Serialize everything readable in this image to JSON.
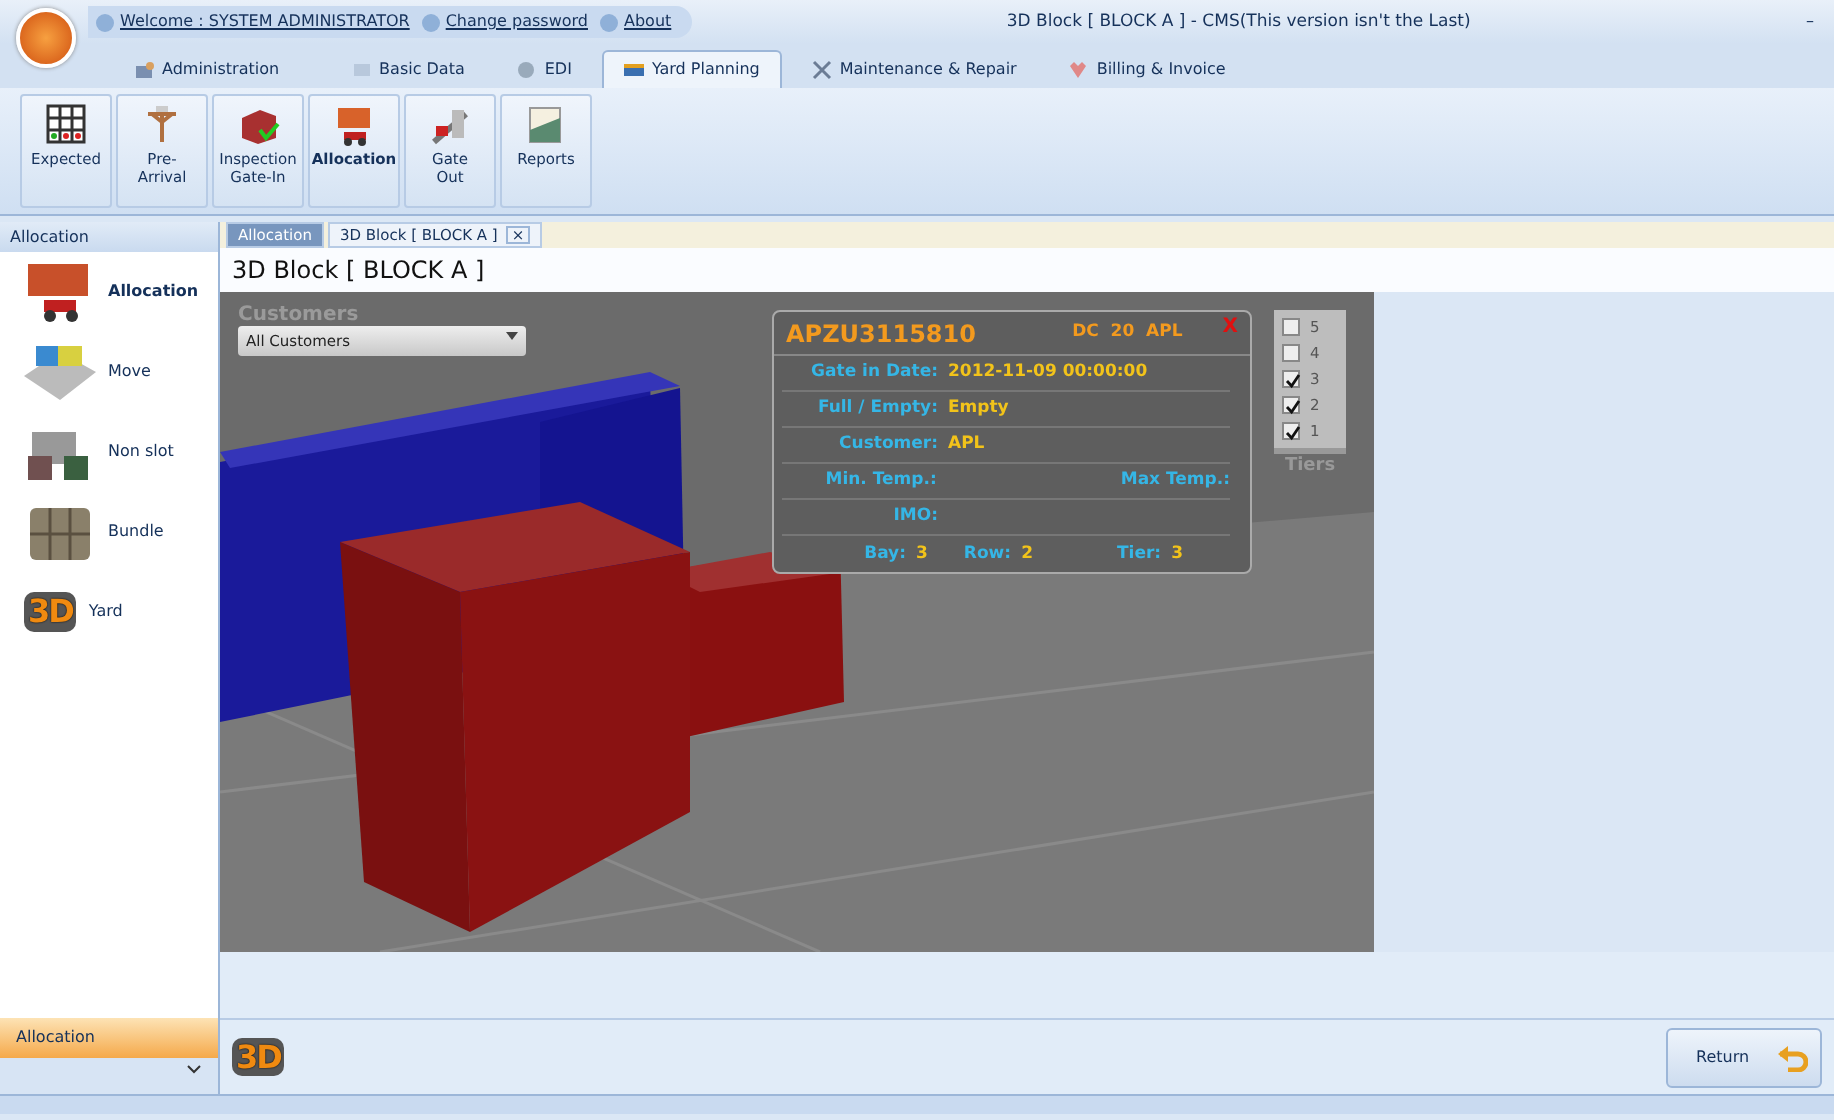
{
  "title_bar": {
    "links": [
      "Welcome : SYSTEM ADMINISTRATOR",
      "Change password",
      "About"
    ],
    "title": "3D Block [ BLOCK A ] - CMS(This version isn't the Last)",
    "minimize": "–"
  },
  "menu_tabs": [
    {
      "label": "Administration",
      "selected": false
    },
    {
      "label": "Basic Data",
      "selected": false
    },
    {
      "label": "EDI",
      "selected": false
    },
    {
      "label": "Yard Planning",
      "selected": true
    },
    {
      "label": "Maintenance & Repair",
      "selected": false
    },
    {
      "label": "Billing & Invoice",
      "selected": false
    }
  ],
  "ribbon": [
    {
      "label": "Expected",
      "kind": "grid",
      "selected": false
    },
    {
      "label": "Pre-Arrival",
      "kind": "crane",
      "selected": false
    },
    {
      "label": "Inspection Gate-In",
      "kind": "inspect",
      "selected": false
    },
    {
      "label": "Allocation",
      "kind": "alloc",
      "selected": true
    },
    {
      "label": "Gate Out",
      "kind": "gate",
      "selected": false
    },
    {
      "label": "Reports",
      "kind": "report",
      "selected": false
    }
  ],
  "sidebar": {
    "header": "Allocation",
    "items": [
      {
        "label": "Allocation",
        "kind": "alloc",
        "selected": true
      },
      {
        "label": "Move",
        "kind": "move",
        "selected": false
      },
      {
        "label": "Non slot",
        "kind": "nonslot",
        "selected": false
      },
      {
        "label": "Bundle",
        "kind": "bundle",
        "selected": false
      },
      {
        "label": "Yard",
        "kind": "yard",
        "badge": "3D",
        "selected": false
      }
    ],
    "footer": "Allocation"
  },
  "doc_tabs": [
    {
      "label": "Allocation",
      "selected": true
    },
    {
      "label": "3D Block [ BLOCK A ]",
      "selected": false,
      "close": "×"
    }
  ],
  "page_title": "3D Block [ BLOCK A ]",
  "viewer": {
    "customers_label": "Customers",
    "customer_select": "All Customers",
    "popup": {
      "container": "APZU3115810",
      "type": "DC",
      "size": "20",
      "line": "APL",
      "close": "X",
      "details": [
        {
          "label": "Gate in Date:",
          "value": "2012-11-09 00:00:00"
        },
        {
          "label": "Full / Empty:",
          "value": "Empty"
        },
        {
          "label": "Customer:",
          "value": "APL"
        }
      ],
      "temps": {
        "min": "Min. Temp.:",
        "max": "Max Temp.:"
      },
      "imo": "IMO:",
      "location": [
        {
          "label": "Bay:",
          "value": "3"
        },
        {
          "label": "Row:",
          "value": "2"
        },
        {
          "label": "Tier:",
          "value": "3"
        }
      ]
    },
    "tiers": {
      "items": [
        {
          "label": "5",
          "checked": false
        },
        {
          "label": "4",
          "checked": false
        },
        {
          "label": "3",
          "checked": true
        },
        {
          "label": "2",
          "checked": true
        },
        {
          "label": "1",
          "checked": true
        }
      ],
      "caption": "Tiers"
    }
  },
  "toolbar": {
    "badge": "3D",
    "return_button": "Return"
  }
}
